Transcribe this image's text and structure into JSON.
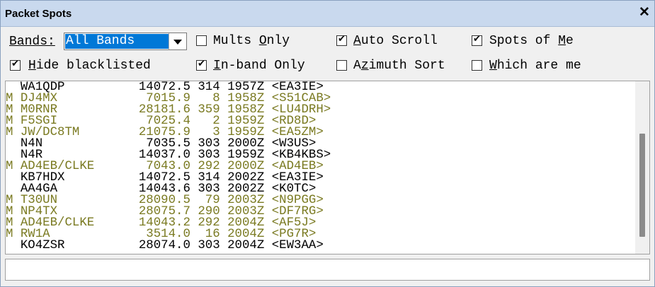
{
  "window": {
    "title": "Packet Spots",
    "close_glyph": "✕"
  },
  "controls": {
    "bands_label": "Bands:",
    "bands_value": "All Bands",
    "mults_only": {
      "label": "Mults Only",
      "checked": false
    },
    "auto_scroll": {
      "label": "Auto Scroll",
      "checked": true
    },
    "spots_of_me": {
      "label": "Spots of Me",
      "checked": true
    },
    "hide_blacklisted": {
      "label": "Hide blacklisted",
      "checked": true
    },
    "inband_only": {
      "label": "In-band Only",
      "checked": true
    },
    "azimuth_sort": {
      "label": "Azimuth Sort",
      "checked": false
    },
    "which_are_me": {
      "label": "Which are me",
      "checked": false
    }
  },
  "colors": {
    "mult": "#7a7a21",
    "normal": "#000000",
    "selection": "#0078d7",
    "titlebar": "#c9d9ee"
  },
  "spots": [
    {
      "text": "  WA1QDP          14072.5 314 1957Z <EA3IE>",
      "mult": false
    },
    {
      "text": "M DJ4MX            7015.9   8 1958Z <S51CAB>",
      "mult": true
    },
    {
      "text": "M M0RNR           28181.6 359 1958Z <LU4DRH>",
      "mult": true
    },
    {
      "text": "M F5SGI            7025.4   2 1959Z <RD8D>",
      "mult": true
    },
    {
      "text": "M JW/DC8TM        21075.9   3 1959Z <EA5ZM>",
      "mult": true
    },
    {
      "text": "  N4N              7035.5 303 2000Z <W3US>",
      "mult": false
    },
    {
      "text": "  N4R             14037.0 303 1959Z <KB4KBS>",
      "mult": false
    },
    {
      "text": "M AD4EB/CLKE       7043.0 292 2000Z <AD4EB>",
      "mult": true
    },
    {
      "text": "  KB7HDX          14072.5 314 2002Z <EA3IE>",
      "mult": false
    },
    {
      "text": "  AA4GA           14043.6 303 2002Z <K0TC>",
      "mult": false
    },
    {
      "text": "M T30UN           28090.5  79 2003Z <N9PGG>",
      "mult": true
    },
    {
      "text": "M NP4TX           28075.7 290 2003Z <DF7RG>",
      "mult": true
    },
    {
      "text": "M AD4EB/CLKE      14043.2 292 2004Z <AF5J>",
      "mult": true
    },
    {
      "text": "M RW1A             3514.0  16 2004Z <PG7R>",
      "mult": true
    },
    {
      "text": "  KO4ZSR          28074.0 303 2004Z <EW3AA>",
      "mult": false
    }
  ],
  "command_input": {
    "value": ""
  }
}
